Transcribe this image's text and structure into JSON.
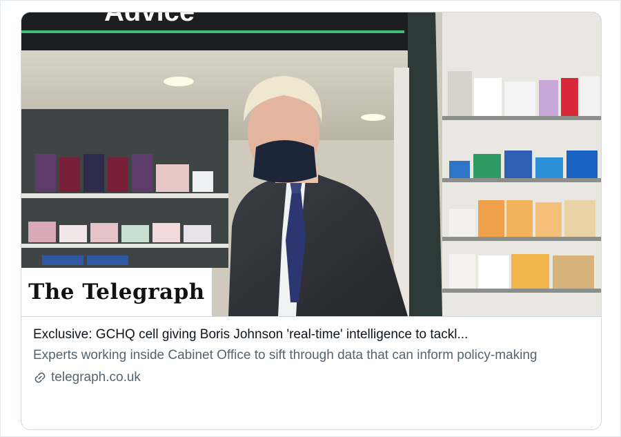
{
  "card": {
    "image_alt": "Boris Johnson in a pharmacy wearing a face mask",
    "publisher_logo": "The Telegraph",
    "store_sign_text": "Advice",
    "title": "Exclusive: GCHQ cell giving Boris Johnson 'real-time' intelligence to tackl...",
    "description": "Experts working inside Cabinet Office to sift through data that can inform policy-making",
    "domain": "telegraph.co.uk",
    "domain_icon": "link-icon"
  }
}
